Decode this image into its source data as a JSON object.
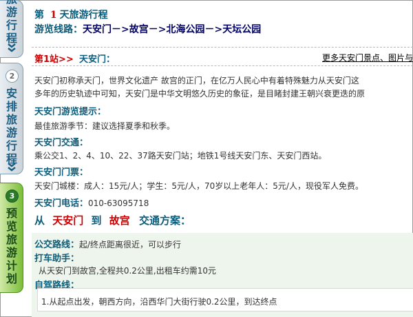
{
  "sidebar": {
    "steps": [
      {
        "num": "1",
        "label_chars": [
          "旅",
          "游",
          "行",
          "程"
        ],
        "active": false
      },
      {
        "num": "2",
        "label_chars": [
          "安",
          "排",
          "旅",
          "游",
          "行",
          "程"
        ],
        "active": false
      },
      {
        "num": "3",
        "label_chars": [
          "预",
          "览",
          "旅",
          "游",
          "计",
          "划"
        ],
        "active": true
      }
    ],
    "chevron_icon": "double-chevron-down-icon"
  },
  "itinerary": {
    "day_prefix": "第",
    "day_num": "1",
    "day_suffix": "天旅游行程",
    "route_label": "游览线路：",
    "route_value": "天安门－>故宫－>北海公园－>天坛公园"
  },
  "station": {
    "label": "第1站>>",
    "name": "天安门：",
    "more_link": "更多天安门景点、图片与",
    "intro_line1": "天安门初称承天门，世界文化遗产 故宫的正门，在亿万人民心中有着特殊魅力从天安门这",
    "intro_line2": "多年的历史轨迹中可知，天安门是中华文明悠久历史的象征，是目睹封建王朝兴衰更迭的原",
    "tips_title": "天安门游览提示：",
    "tips_text": "最佳旅游季节：建议选择夏季和秋季。",
    "transport_title": "天安门交通：",
    "transport_text": "乘公交1、2、4、10、22、37路天安门站；地铁1号线天安门东、天安门西站。",
    "ticket_title": "天安门门票：",
    "ticket_text": "天安门城楼：成人：15元/人；学生：5元/人，70岁以上老年人：5元/人，现役军人免费。",
    "phone_label": "天安门电话：",
    "phone_value": "010-63095718"
  },
  "transfer": {
    "from_label": "从",
    "from": "天安门",
    "to_label": "到",
    "to": "故宫",
    "plan_label": "交通方案：",
    "bus_label": "公交路线：",
    "bus_text": "起/终点距离很近，可以步行",
    "taxi_label": "打车助手：",
    "taxi_text": "从天安门到故宫,全程共0.2公里,出租车约需10元",
    "drive_label": "自驾路线：",
    "drive_text": "1.从起点出发，朝西方向，沿西华门大街行驶0.2公里，到达终点"
  }
}
